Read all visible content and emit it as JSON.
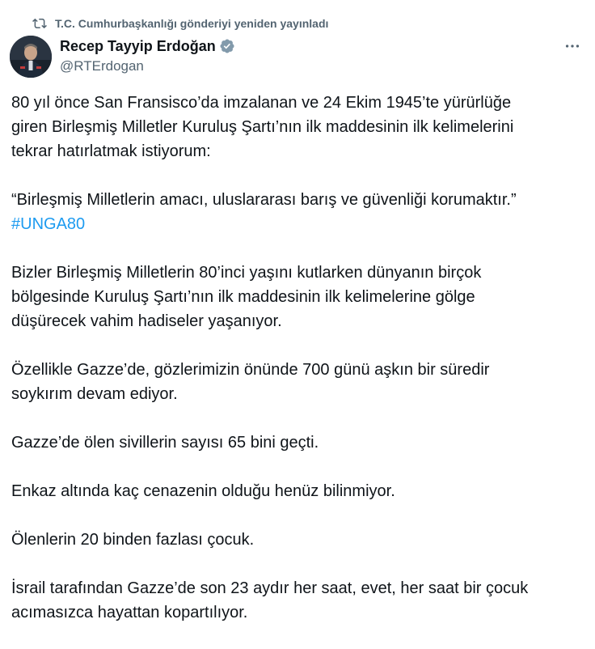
{
  "repost": {
    "icon": "repost-icon",
    "text": "T.C. Cumhurbaşkanlığı gönderiyi yeniden yayınladı"
  },
  "author": {
    "name": "Recep Tayyip Erdoğan",
    "handle": "@RTErdogan",
    "verified_color": "#829aab"
  },
  "tweet": {
    "paragraphs": [
      "80 yıl önce San Fransisco’da imzalanan ve 24 Ekim 1945’te yürürlüğe\ngiren Birleşmiş Milletler Kuruluş Şartı’nın ilk maddesinin ilk kelimelerini\ntekrar hatırlatmak istiyorum:",
      "“Birleşmiş Milletlerin amacı, uluslararası barış ve güvenliği korumaktır.”",
      "Bizler Birleşmiş Milletlerin 80’inci yaşını kutlarken dünyanın birçok\nbölgesinde Kuruluş Şartı’nın ilk maddesinin ilk kelimelerine gölge\ndüşürecek vahim hadiseler yaşanıyor.",
      "Özellikle Gazze’de, gözlerimizin önünde 700 günü aşkın bir süredir\nsoykırım devam ediyor.",
      "Gazze’de ölen sivillerin sayısı 65 bini geçti.",
      "Enkaz altında kaç cenazenin olduğu henüz bilinmiyor.",
      "Ölenlerin 20 binden fazlası çocuk.",
      "İsrail tarafından Gazze’de son 23 aydır her saat, evet, her saat bir çocuk\nacımasızca hayattan kopartılıyor."
    ],
    "hashtag": "#UNGA80",
    "hashtag_color": "#1d9bf0"
  }
}
